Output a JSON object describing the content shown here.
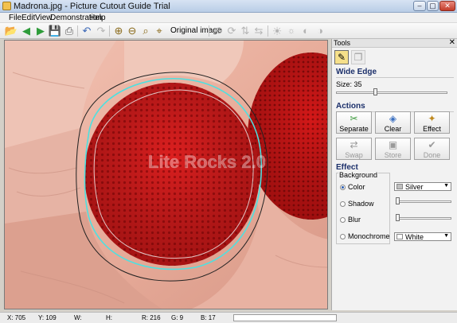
{
  "window": {
    "title": "Madrona.jpg - Picture Cutout Guide Trial",
    "min": "–",
    "max": "▢",
    "close": "✕"
  },
  "menu": [
    "File",
    "Edit",
    "View",
    "Demonstration",
    "Help"
  ],
  "toolbar": {
    "original_image_label": "Original image"
  },
  "watermark": "Lite Rocks 2.0",
  "tools": {
    "header": "Tools",
    "close": "✕",
    "wide_edge_label": "Wide Edge",
    "size_label": "Size: 35",
    "size_value": 35,
    "actions_label": "Actions",
    "buttons": {
      "separate": "Separate",
      "clear": "Clear",
      "effect": "Effect",
      "swap": "Swap",
      "store": "Store",
      "done": "Done"
    },
    "effect_label": "Effect",
    "background_label": "Background",
    "options": {
      "color": "Color",
      "shadow": "Shadow",
      "blur": "Blur",
      "monochrome": "Monochrome"
    },
    "color_combo": "Silver",
    "mono_combo": "White",
    "colors": {
      "silver": "#c0c0c0",
      "white": "#ffffff"
    }
  },
  "status": {
    "x": "X: 705",
    "y": "Y: 109",
    "w": "W:",
    "h": "H:",
    "r": "R: 216",
    "g": "G: 9",
    "b": "B: 17"
  }
}
